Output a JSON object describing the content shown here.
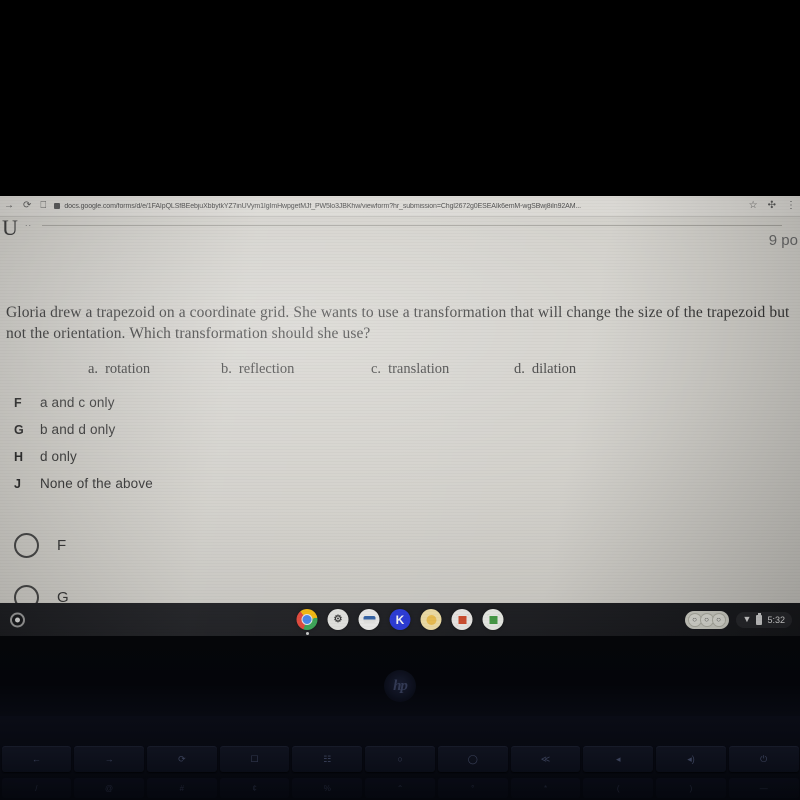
{
  "browser": {
    "nav": {
      "forward_icon": "forward-arrow-icon",
      "forward_glyph": "→",
      "reload_icon": "reload-icon",
      "reload_glyph": "⟳",
      "tab_icon": "tab-icon",
      "tab_glyph": "⎕"
    },
    "omnibox": {
      "lock_icon": "site-info-icon",
      "url": "docs.google.com/forms/d/e/1FAIpQLSfBEebjuXbbytkYZ7inUVym1IgImHwpgetMJf_PW5lo3JBKhw/viewform?hr_submission=Chgl2672g0ESEAIk6emM-wgSBwj8iIn92AM..."
    },
    "actions": {
      "bookmark_icon": "star-icon",
      "bookmark_glyph": "☆",
      "extensions_icon": "puzzle-piece-icon",
      "extensions_glyph": "✣",
      "menu_icon": "three-dot-menu-icon",
      "menu_glyph": "⋮"
    }
  },
  "form": {
    "cut_top_letter": "U",
    "cut_top_dots": "..",
    "points_cut": "9 po",
    "question": "Gloria drew a trapezoid on a coordinate grid.  She wants to use a transformation that will change the size of the trapezoid but not the orientation.  Which transformation should she use?",
    "inline_choices": [
      {
        "label": "a.",
        "text": "rotation"
      },
      {
        "label": "b.",
        "text": "reflection"
      },
      {
        "label": "c.",
        "text": "translation"
      },
      {
        "label": "d.",
        "text": "dilation"
      }
    ],
    "combo_choices": [
      {
        "key": "F",
        "text": "a and c only"
      },
      {
        "key": "G",
        "text": "b and d only"
      },
      {
        "key": "H",
        "text": "d only"
      },
      {
        "key": "J",
        "text": "None of the above"
      }
    ],
    "radio_options": [
      {
        "label": "F",
        "selected": false
      },
      {
        "label": "G",
        "selected": false
      }
    ]
  },
  "shelf": {
    "launcher_icon": "launcher-icon",
    "apps": [
      {
        "name": "chrome-icon",
        "label": ""
      },
      {
        "name": "settings-gear-icon",
        "label": "⚙"
      },
      {
        "name": "blue-app-icon",
        "label": ""
      },
      {
        "name": "kahoot-icon",
        "label": "K"
      },
      {
        "name": "yellow-app-icon",
        "label": ""
      },
      {
        "name": "red-app-icon",
        "label": ""
      },
      {
        "name": "green-app-icon",
        "label": ""
      }
    ],
    "tray": {
      "avatars": [
        "○",
        "○",
        "○"
      ],
      "wifi_icon": "wifi-icon",
      "wifi_glyph": "▼",
      "battery_icon": "battery-icon",
      "clock": "5:32"
    }
  },
  "laptop": {
    "brand": "hp",
    "function_keys": [
      "←",
      "→",
      "⟳",
      "☐",
      "☷",
      "○",
      "◯",
      "≪",
      "◂",
      "◂)",
      "⏻"
    ],
    "number_row": [
      "/",
      "@",
      "#",
      "¢",
      "%",
      "⌃",
      "°",
      "*",
      "(",
      ")",
      "—"
    ]
  }
}
